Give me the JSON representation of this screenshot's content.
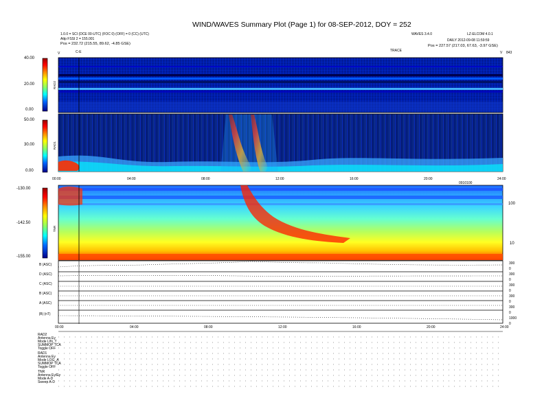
{
  "header": {
    "title": "WIND/WAVES Summary Plot (Page 1) for 08-SEP-2012, DOY = 252",
    "left_line1": "1.0.0 = SCI (DCE 00-UTC) (FOC 0) (OFF) = 0 (CC) (UTC)",
    "left_line2": "Attp FSSI 2 = 155.001",
    "left_line3": "Pos = 232.72 (215.55, 89.62, -4.85 GSE)",
    "right_top_left": "WAVES 3.4.0",
    "right_top_right": "LZ-ELCOM 4.0.1",
    "right_line2": "DAILY 2012-09-08 11:59:59",
    "right_line3": "Pos = 227.57 (217.03, 67.63, -3.97 GSE)",
    "trace_label": "TRACE",
    "left_tick": "C-E",
    "left_small": "V",
    "right_small_left": "V",
    "right_small_right": "843"
  },
  "panels": {
    "rad2": {
      "name": "RAD2",
      "ticks": [
        "40.00",
        "20.00",
        "0.00"
      ]
    },
    "rad1": {
      "name": "RAD1",
      "ticks": [
        "50.00",
        "30.00",
        "0.00"
      ]
    },
    "tnr": {
      "name": "TNR",
      "ticks": [
        "-130.00",
        "-142.50",
        "-155.00"
      ],
      "right_ticks": [
        "100",
        "10"
      ]
    },
    "mag": {
      "rows": [
        "B (ASC)",
        "D (ASC)",
        "C (ASC)",
        "B (ASC)",
        "A (ASC)",
        "|B| (nT)"
      ],
      "right_ticks": [
        "300",
        "0",
        "300",
        "0",
        "300",
        "0",
        "300",
        "0",
        "300",
        "0",
        "1000",
        "0"
      ]
    }
  },
  "time_axis": [
    "00:00",
    "04:00",
    "08:00",
    "12:00",
    "16:00",
    "20:00",
    "24:00"
  ],
  "time_axis_note": "0910100",
  "footer_left": [
    "RAD2",
    "Antenna  Ey",
    "Mode  LIN_T",
    "SUMMOP  TCA",
    "Toggle  OFF",
    "RAD1",
    "Antenna  Ey",
    "Mode  LOG_A",
    "SUMMOP  TCA",
    "Toggle  OFF",
    "TNR",
    "Antenna  Ey/Ey",
    "Mode  A-D",
    "Sweep  A-D"
  ],
  "chart_data": {
    "type": "heatmap",
    "title": "WIND/WAVES Summary Plot (Page 1) for 08-SEP-2012, DOY = 252",
    "x": [
      "00:00",
      "04:00",
      "08:00",
      "12:00",
      "16:00",
      "20:00",
      "24:00"
    ],
    "xlim": [
      0,
      24
    ],
    "panels": [
      {
        "name": "RAD2",
        "ylim": [
          0,
          40
        ],
        "ticks": [
          0,
          20,
          40
        ]
      },
      {
        "name": "RAD1",
        "ylim": [
          0,
          50
        ],
        "ticks": [
          0,
          30,
          50
        ]
      },
      {
        "name": "TNR",
        "ylim": [
          -155,
          -130
        ],
        "ticks": [
          -155,
          -142.5,
          -130
        ]
      }
    ],
    "events": [
      {
        "type": "radio burst",
        "start_hour": 9.8,
        "end_hour": 12.6
      },
      {
        "type": "radio burst",
        "start_hour": 10.7,
        "end_hour": 11.4
      }
    ],
    "colors": [
      "#00007a",
      "#0000ff",
      "#00aaff",
      "#00ffff",
      "#88ff66",
      "#ffff00",
      "#ff8800",
      "#ff0000",
      "#990000"
    ]
  }
}
